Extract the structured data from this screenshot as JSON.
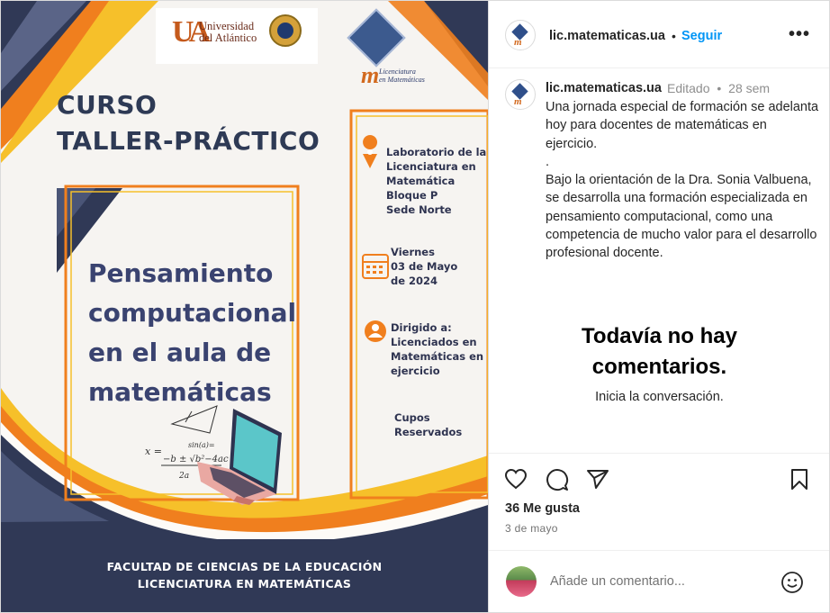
{
  "poster": {
    "ua_mark": "UA",
    "ua_name_line1": "Universidad",
    "ua_name_line2": "del Atlántico",
    "lm_initial": "m",
    "lm_text_line1": "Licenciatura",
    "lm_text_line2": "en Matemáticas",
    "curso_line1": "CURSO",
    "curso_line2": "TALLER-PRÁCTICO",
    "title_lines": [
      "Pensamiento",
      "computacional",
      "en el aula de",
      "matemáticas"
    ],
    "location_lines": [
      "Laboratorio de la",
      "Licenciatura en",
      "Matemática",
      "Bloque P",
      "Sede Norte"
    ],
    "date_lines": [
      "Viernes",
      "03 de Mayo",
      "de 2024"
    ],
    "audience_lines": [
      "Dirigido a:",
      "Licenciados en",
      "Matemáticas en",
      "ejercicio"
    ],
    "seats_lines": [
      "Cupos",
      "Reservados"
    ],
    "footer_line1": "FACULTAD DE CIENCIAS DE LA EDUCACIÓN",
    "footer_line2": "LICENCIATURA EN MATEMÁTICAS",
    "colors": {
      "navy": "#303956",
      "orange": "#f07f1e",
      "yellow": "#f6c02a",
      "title": "#3a4370"
    }
  },
  "header": {
    "username": "lic.matematicas.ua",
    "separator": "•",
    "follow_label": "Seguir",
    "more_icon": "more-horizontal-icon"
  },
  "caption": {
    "username": "lic.matematicas.ua",
    "edited": "Editado",
    "separator": "•",
    "age": "28 sem",
    "text": "Una jornada especial de formación se adelanta hoy para docentes de matemáticas en ejercicio.\n.\nBajo la orientación de la Dra. Sonia Valbuena, se desarrolla una formación especializada en pensamiento computacional, como una competencia de mucho valor para el desarrollo profesional docente."
  },
  "comments": {
    "empty_title_line1": "Todavía no hay",
    "empty_title_line2": "comentarios.",
    "empty_subtitle": "Inicia la conversación."
  },
  "actions": {
    "like_icon": "heart-icon",
    "comment_icon": "comment-icon",
    "share_icon": "share-icon",
    "save_icon": "bookmark-icon",
    "likes": "36 Me gusta",
    "date": "3 de mayo"
  },
  "add_comment": {
    "placeholder": "Añade un comentario...",
    "emoji_icon": "smiley-icon"
  }
}
